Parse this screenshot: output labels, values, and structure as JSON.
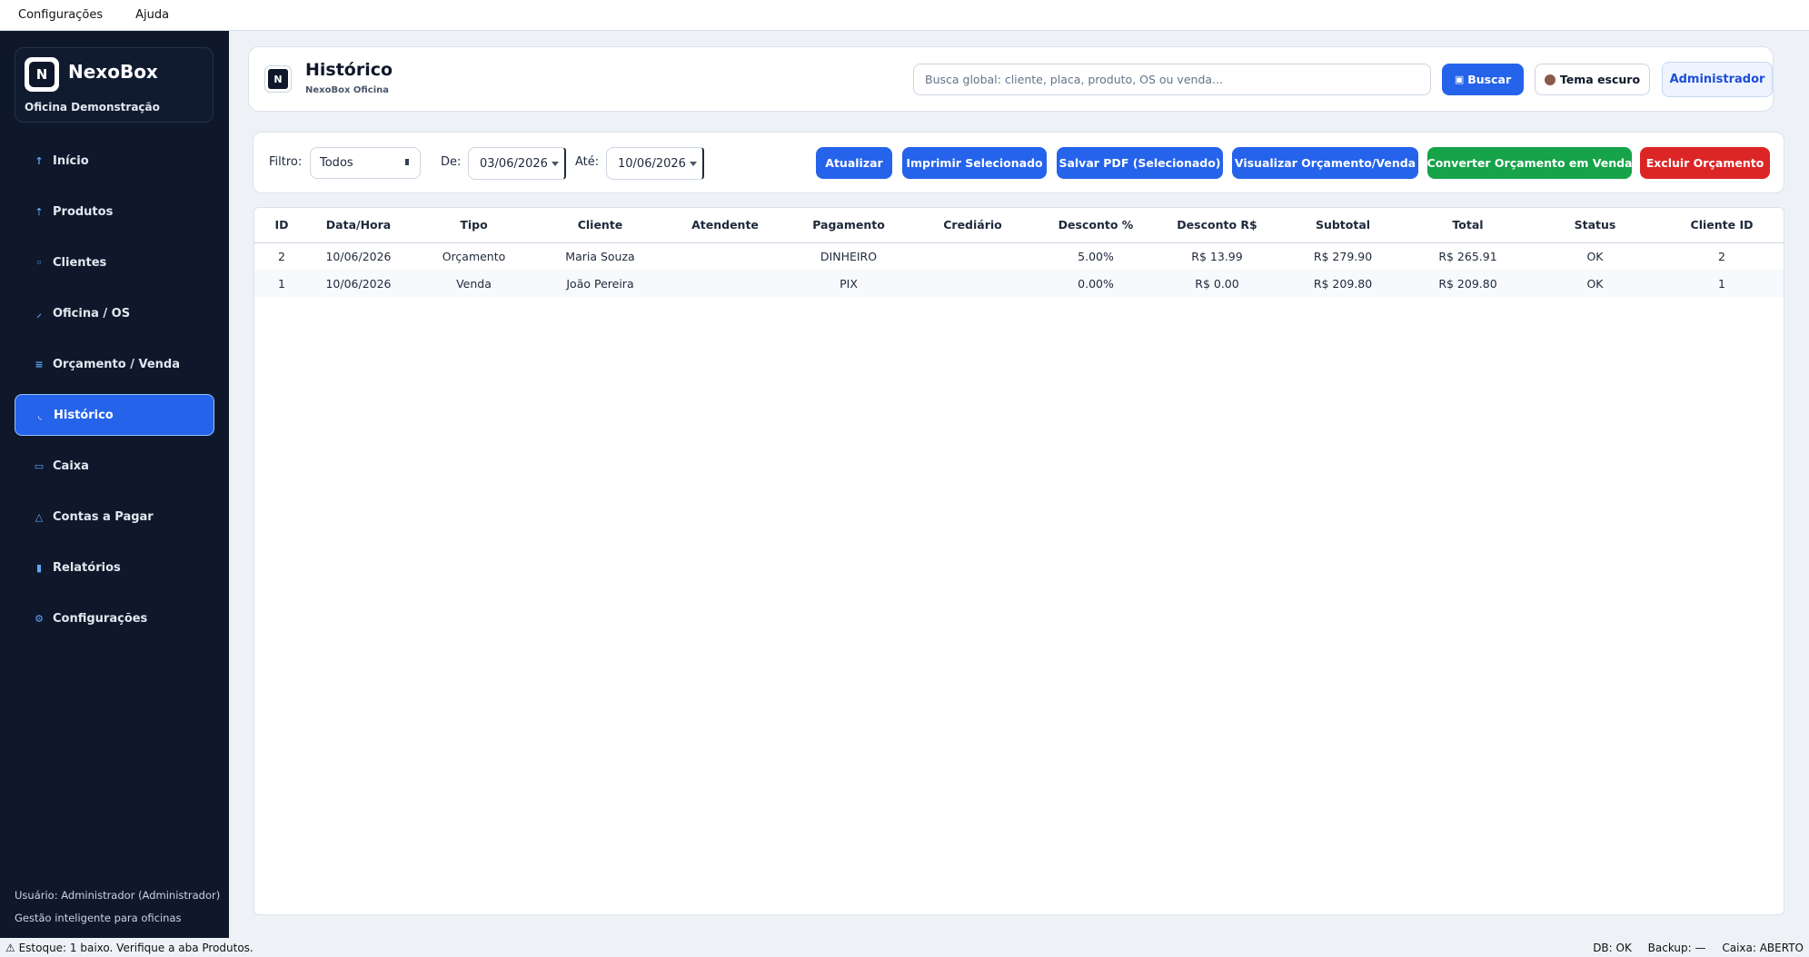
{
  "menubar": {
    "items": [
      "Configurações",
      "Ajuda"
    ]
  },
  "sidebar": {
    "brand_name": "NexoBox",
    "brand_sub": "Oficina Demonstração",
    "items": [
      {
        "label": "Início",
        "icon": "arrow-up-icon"
      },
      {
        "label": "Produtos",
        "icon": "tag-icon"
      },
      {
        "label": "Clientes",
        "icon": "user-icon"
      },
      {
        "label": "Oficina / OS",
        "icon": "wrench-icon"
      },
      {
        "label": "Orçamento / Venda",
        "icon": "list-icon"
      },
      {
        "label": "Histórico",
        "icon": "clock-icon",
        "active": true
      },
      {
        "label": "Caixa",
        "icon": "cash-icon"
      },
      {
        "label": "Contas a Pagar",
        "icon": "triangle-icon"
      },
      {
        "label": "Relatórios",
        "icon": "bar-chart-icon"
      },
      {
        "label": "Configurações",
        "icon": "gear-icon"
      }
    ],
    "user_line": "Usuário: Administrador (Administrador)",
    "tagline": "Gestão inteligente para oficinas"
  },
  "header": {
    "title": "Histórico",
    "subtitle": "NexoBox Oficina",
    "search_placeholder": "Busca global: cliente, placa, produto, OS ou venda...",
    "search_button": "Buscar",
    "theme_button": "Tema escuro",
    "user_button": "Administrador"
  },
  "toolbar": {
    "filter_label": "Filtro:",
    "filter_value": "Todos",
    "from_label": "De:",
    "from_value": "03/06/2026",
    "to_label": "Até:",
    "to_value": "10/06/2026",
    "actions": [
      {
        "label": "Atualizar",
        "color": "#2563eb"
      },
      {
        "label": "Imprimir Selecionado",
        "color": "#2563eb"
      },
      {
        "label": "Salvar PDF (Selecionado)",
        "color": "#2563eb"
      },
      {
        "label": "Visualizar Orçamento/Venda",
        "color": "#2563eb"
      },
      {
        "label": "Converter Orçamento em Venda",
        "color": "#16a34a"
      },
      {
        "label": "Excluir Orçamento",
        "color": "#dc2626"
      }
    ]
  },
  "table": {
    "columns": [
      "ID",
      "Data/Hora",
      "Tipo",
      "Cliente",
      "Atendente",
      "Pagamento",
      "Crediário",
      "Desconto %",
      "Desconto R$",
      "Subtotal",
      "Total",
      "Status",
      "Cliente ID"
    ],
    "rows": [
      [
        "2",
        "10/06/2026",
        "Orçamento",
        "Maria Souza",
        "",
        "DINHEIRO",
        "",
        "5.00%",
        "R$ 13.99",
        "R$ 279.90",
        "R$ 265.91",
        "OK",
        "2"
      ],
      [
        "1",
        "10/06/2026",
        "Venda",
        "João Pereira",
        "",
        "PIX",
        "",
        "0.00%",
        "R$ 0.00",
        "R$ 209.80",
        "R$ 209.80",
        "OK",
        "1"
      ]
    ]
  },
  "statusbar": {
    "left": "⚠ Estoque: 1 baixo. Verifique a aba Produtos.",
    "db": "DB: OK",
    "backup": "Backup: —",
    "caixa": "Caixa: ABERTO"
  }
}
